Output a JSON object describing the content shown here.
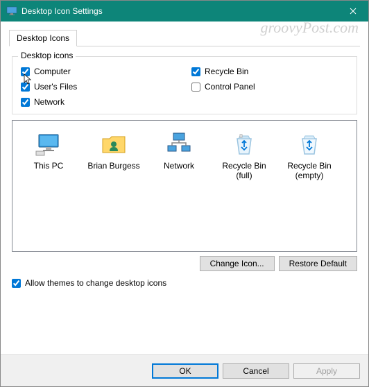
{
  "window": {
    "title": "Desktop Icon Settings"
  },
  "tabs": {
    "desktop_icons": "Desktop Icons"
  },
  "groupbox": {
    "label": "Desktop icons",
    "checkboxes": {
      "computer": "Computer",
      "users_files": "User's Files",
      "network": "Network",
      "recycle_bin": "Recycle Bin",
      "control_panel": "Control Panel"
    }
  },
  "icons": {
    "this_pc": "This PC",
    "user_folder": "Brian Burgess",
    "network": "Network",
    "recycle_full": "Recycle Bin (full)",
    "recycle_empty": "Recycle Bin (empty)"
  },
  "buttons": {
    "change_icon": "Change Icon...",
    "restore_default": "Restore Default",
    "ok": "OK",
    "cancel": "Cancel",
    "apply": "Apply"
  },
  "allow_themes": "Allow themes to change desktop icons",
  "watermark": "groovyPost.com"
}
